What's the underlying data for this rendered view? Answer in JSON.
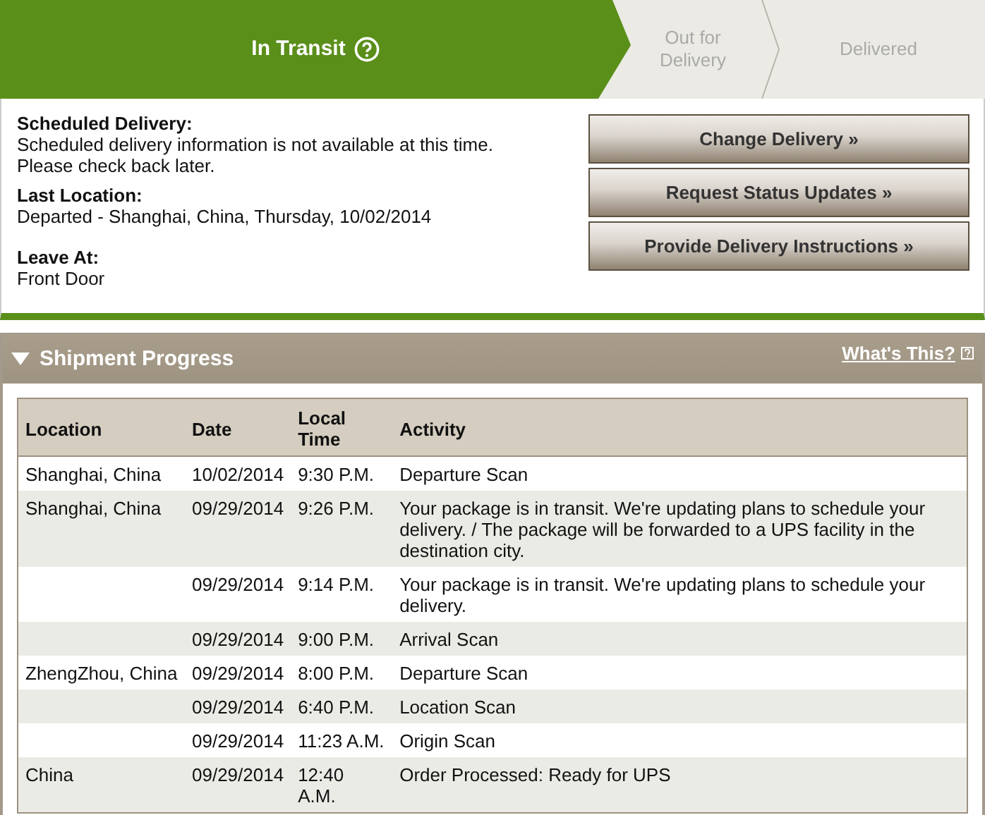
{
  "progress_steps": [
    {
      "label": "In Transit",
      "selected": true
    },
    {
      "label": "Out for Delivery",
      "selected": false
    },
    {
      "label": "Delivered",
      "selected": false
    }
  ],
  "details": [
    {
      "label": "Scheduled Delivery:",
      "value": "Scheduled delivery information is not available at this time. Please check back later."
    },
    {
      "label": "Last Location:",
      "value": "Departed - Shanghai, China, Thursday, 10/02/2014"
    },
    {
      "label": "Leave At:",
      "value": "Front Door"
    }
  ],
  "buttons": [
    "Change Delivery »",
    "Request Status Updates »",
    "Provide Delivery Instructions »"
  ],
  "shipment_progress": {
    "title": "Shipment Progress",
    "expanded": true,
    "help_link": "What's This?",
    "table": {
      "columns": [
        "Location",
        "Date",
        "Local Time",
        "Activity"
      ],
      "rows": [
        [
          "Shanghai, China",
          "10/02/2014",
          "9:30 P.M.",
          "Departure Scan"
        ],
        [
          "Shanghai, China",
          "09/29/2014",
          "9:26 P.M.",
          "Your package is in transit. We're updating plans to schedule your delivery. / The package will be forwarded to a UPS facility in the destination city."
        ],
        [
          "",
          "09/29/2014",
          "9:14 P.M.",
          "Your package is in transit. We're updating plans to schedule your delivery."
        ],
        [
          "",
          "09/29/2014",
          "9:00 P.M.",
          "Arrival Scan"
        ],
        [
          "ZhengZhou, China",
          "09/29/2014",
          "8:00 P.M.",
          "Departure Scan"
        ],
        [
          "",
          "09/29/2014",
          "6:40 P.M.",
          "Location Scan"
        ],
        [
          "",
          "09/29/2014",
          "11:23 A.M.",
          "Origin Scan"
        ],
        [
          "China",
          "09/29/2014",
          "12:40 A.M.",
          "Order Processed: Ready for UPS"
        ]
      ]
    }
  }
}
